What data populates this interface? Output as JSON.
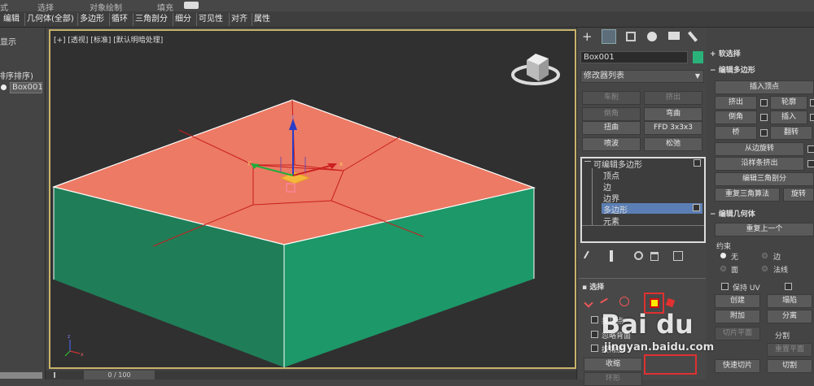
{
  "menubar": {
    "items": [
      "式",
      "选择",
      "对象绘制",
      "填充"
    ]
  },
  "tabs": [
    "编辑",
    "几何体(全部)",
    "多边形",
    "循环",
    "三角剖分",
    "细分",
    "可见性",
    "对齐",
    "属性"
  ],
  "left": {
    "display": "显示",
    "sort": "排序排序)",
    "object": "Box001"
  },
  "viewport": {
    "label": "[+] [透视] [标准] [默认明暗处理]",
    "gizmo": {
      "x": "x",
      "y": "y",
      "z": "z"
    }
  },
  "timeline": {
    "frame": "0 / 100"
  },
  "cmd": {
    "object_name": "Box001",
    "object_color": "#2ab27a",
    "modifier_list": "修改器列表",
    "buttons": [
      {
        "label": "车削",
        "enabled": false
      },
      {
        "label": "挤出",
        "enabled": false
      },
      {
        "label": "倒角",
        "enabled": false
      },
      {
        "label": "弯曲",
        "enabled": true
      },
      {
        "label": "扭曲",
        "enabled": true
      },
      {
        "label": "FFD 3x3x3",
        "enabled": true
      },
      {
        "label": "喷波",
        "enabled": true
      },
      {
        "label": "松弛",
        "enabled": true
      }
    ],
    "stack": {
      "root": "可编辑多边形",
      "items": [
        "顶点",
        "边",
        "边界",
        "多边形",
        "元素"
      ],
      "selected": 3
    },
    "selection": {
      "title": "选择",
      "by_vertex": "按顶点",
      "ignore_back": "忽略背面",
      "by_angle": "按角度:",
      "shrink": "收缩",
      "ring": "环形"
    }
  },
  "right": {
    "soft_select": "软选择",
    "edit_poly": "编辑多边形",
    "insert_vertex": "插入顶点",
    "extrude": "挤出",
    "outline": "轮廓",
    "bevel": "倒角",
    "inset": "插入",
    "bridge": "桥",
    "flip": "翻转",
    "hinge": "从边旋转",
    "extrude_spline": "沿样条挤出",
    "edit_tri": "编辑三角剖分",
    "retri": "重复三角算法",
    "turn": "旋转",
    "edit_geom": "编辑几何体",
    "repeat_last": "重复上一个",
    "constraints": "约束",
    "c_none": "无",
    "c_edge": "边",
    "c_face": "面",
    "c_normal": "法线",
    "keep_uv": "保持 UV",
    "create": "创建",
    "collapse": "塌陷",
    "attach": "附加",
    "detach": "分离",
    "slice_plane": "切片平面",
    "split": "分割",
    "quickslice": "快速切片",
    "cut": "切割",
    "reset_plane": "重置平面"
  },
  "watermark": {
    "text": "Bai du",
    "sub": "jingyan.baidu.com"
  },
  "colors": {
    "top_face": "#ec7a64",
    "side_face": "#1e8a5e",
    "highlight": "#e53434"
  }
}
